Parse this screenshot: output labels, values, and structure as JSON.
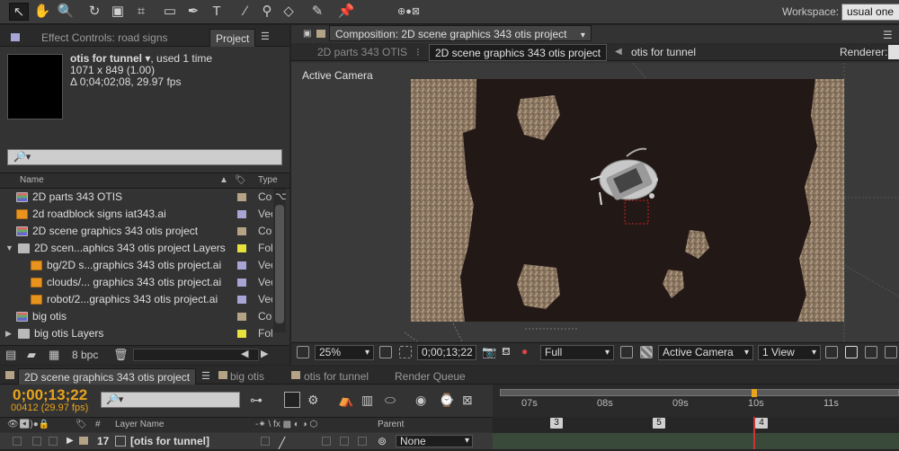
{
  "toolbar": {
    "workspace_label": "Workspace:",
    "workspace_value": "usual one"
  },
  "left_panel": {
    "tabs": [
      "Effect Controls: road signs",
      "Project"
    ],
    "comp_info": {
      "name": "otis for tunnel",
      "used": ", used 1 time",
      "size": "1071 x 849 (1.00)",
      "duration": "Δ 0;04;02;08, 29.97 fps"
    },
    "search_placeholder": "🔎▾",
    "columns": {
      "name": "Name",
      "type": "Type"
    },
    "items": [
      {
        "name": "2D parts 343 OTIS",
        "type": "Comp",
        "icon": "composition-icon",
        "label_color": "#b4a384",
        "indent": 0
      },
      {
        "name": "2d roadblock signs iat343.ai",
        "type": "Vector",
        "icon": "illustrator-file-icon",
        "label_color": "#a6a5d6",
        "indent": 0
      },
      {
        "name": "2D scene graphics 343 otis project",
        "type": "Comp",
        "icon": "composition-icon",
        "label_color": "#b4a384",
        "indent": 0
      },
      {
        "name": "2D scen...aphics 343 otis project Layers",
        "type": "Folder",
        "icon": "folder-icon",
        "label_color": "#e6e13c",
        "indent": 0,
        "expanded": true
      },
      {
        "name": "bg/2D s...graphics 343 otis project.ai",
        "type": "Vector",
        "icon": "illustrator-file-icon",
        "label_color": "#a6a5d6",
        "indent": 1
      },
      {
        "name": "clouds/... graphics 343 otis project.ai",
        "type": "Vector",
        "icon": "illustrator-file-icon",
        "label_color": "#a6a5d6",
        "indent": 1
      },
      {
        "name": "robot/2...graphics 343 otis project.ai",
        "type": "Vector",
        "icon": "illustrator-file-icon",
        "label_color": "#a6a5d6",
        "indent": 1
      },
      {
        "name": "big otis",
        "type": "Comp",
        "icon": "composition-icon",
        "label_color": "#b4a384",
        "indent": 0
      },
      {
        "name": "big otis Layers",
        "type": "Folder",
        "icon": "folder-icon",
        "label_color": "#e6e13c",
        "indent": 0,
        "expanded": false
      }
    ],
    "bpc": "8 bpc"
  },
  "comp_panel": {
    "tab": "Composition: 2D scene graphics 343 otis project",
    "flow": [
      "2D parts 343 OTIS",
      "2D scene graphics 343 otis project",
      "otis for tunnel"
    ],
    "renderer_label": "Renderer:",
    "active_camera_label": "Active Camera",
    "viewer_bar": {
      "zoom": "25%",
      "timecode": "0;00;13;22",
      "resolution": "Full",
      "view": "Active Camera",
      "views_count": "1 View"
    }
  },
  "timeline": {
    "tabs": [
      "2D scene graphics 343 otis project",
      "big otis",
      "otis for tunnel",
      "Render Queue"
    ],
    "timecode": "0;00;13;22",
    "frames": "00412 (29.97 fps)",
    "search_placeholder": "🔎▾",
    "columns": {
      "layer_name": "Layer Name",
      "parent": "Parent"
    },
    "layer": {
      "number": "17",
      "name": "[otis for tunnel]",
      "parent": "None"
    },
    "ruler_labels": [
      "07s",
      "08s",
      "09s",
      "10s",
      "11s"
    ],
    "markers": [
      "3",
      "5",
      "4"
    ]
  }
}
